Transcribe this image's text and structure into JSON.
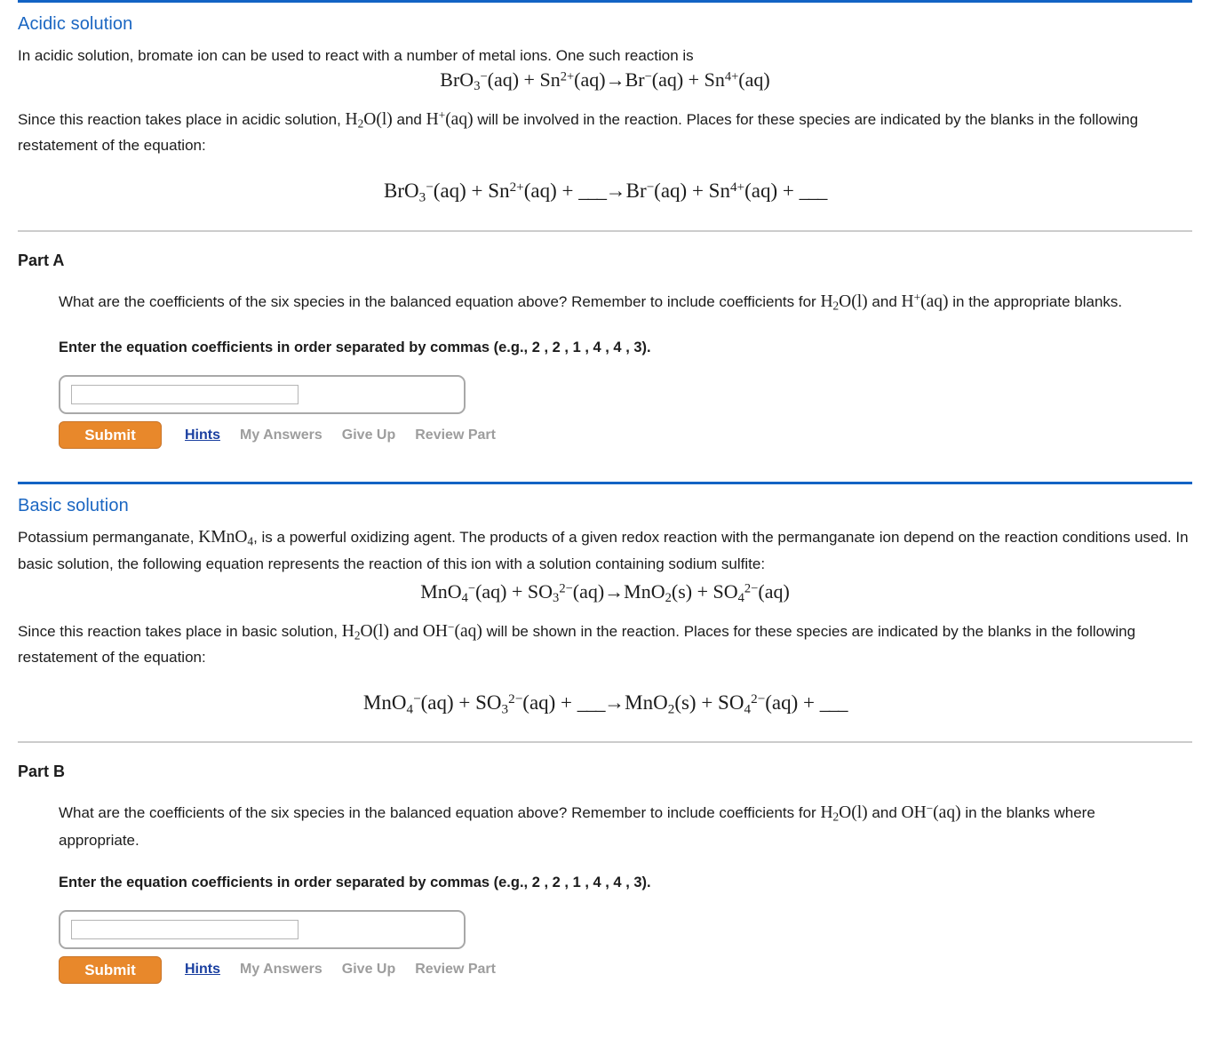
{
  "colors": {
    "section_rule": "#1263c4",
    "section_heading": "#1a66c2",
    "divider": "#cccccc",
    "submit_bg": "#e8882b",
    "link_active": "#1a3fa0",
    "link_disabled": "#9d9d9d"
  },
  "sections": {
    "acidic": {
      "heading": "Acidic solution",
      "intro_text": "In acidic solution, bromate ion can be used to react with a number of metal ions. One such reaction is",
      "equation_plain": "BrO3^-(aq) + Sn^2+(aq) → Br^-(aq) + Sn^4+(aq)",
      "since_text_1": "Since this reaction takes place in acidic solution,",
      "since_species_1": "H2O(l)",
      "since_and": "and",
      "since_species_2": "H+(aq)",
      "since_text_2": "will be involved in the reaction. Places for these species are indicated by the blanks in the following restatement of the equation:",
      "restated_equation_plain": "BrO3^-(aq) + Sn^2+(aq) + ___ → Br^-(aq) + Sn^4+(aq) + ___"
    },
    "basic": {
      "heading": "Basic solution",
      "intro_text_1": "Potassium permanganate,",
      "intro_formula": "KMnO4",
      "intro_text_2": ", is a powerful oxidizing agent. The products of a given redox reaction with the permanganate ion depend on the reaction conditions used. In basic solution, the following equation represents the reaction of this ion with a solution containing sodium sulfite:",
      "equation_plain": "MnO4^-(aq) + SO3^2-(aq) → MnO2(s) + SO4^2-(aq)",
      "since_text_1": "Since this reaction takes place in basic solution,",
      "since_species_1": "H2O(l)",
      "since_and": "and",
      "since_species_2": "OH-(aq)",
      "since_text_2": "will be shown in the reaction. Places for these species are indicated by the blanks in the following restatement of the equation:",
      "restated_equation_plain": "MnO4^-(aq) + SO3^2-(aq) + ___ → MnO2(s) + SO4^2-(aq) + ___"
    }
  },
  "parts": {
    "a": {
      "title": "Part A",
      "question_text_1": "What are the coefficients of the six species in the balanced equation above? Remember to include coefficients for",
      "question_species_1": "H2O(l)",
      "question_and": "and",
      "question_species_2": "H+(aq)",
      "question_text_2": "in the appropriate blanks.",
      "instruction_prefix": "Enter the equation coefficients in order separated by commas (e.g., ",
      "instruction_example": "2 , 2 , 1 , 4 , 4 , 3",
      "instruction_suffix": ").",
      "input_value": "",
      "input_placeholder": "",
      "submit_label": "Submit",
      "links": {
        "hints": "Hints",
        "my_answers": "My Answers",
        "give_up": "Give Up",
        "review_part": "Review Part"
      }
    },
    "b": {
      "title": "Part B",
      "question_text_1": "What are the coefficients of the six species in the balanced equation above? Remember to include coefficients for",
      "question_species_1": "H2O(l)",
      "question_and": "and",
      "question_species_2": "OH-(aq)",
      "question_text_2": "in the blanks where appropriate.",
      "instruction_prefix": "Enter the equation coefficients in order separated by commas (e.g., ",
      "instruction_example": "2 , 2 , 1 , 4 , 4 , 3",
      "instruction_suffix": ").",
      "input_value": "",
      "input_placeholder": "",
      "submit_label": "Submit",
      "links": {
        "hints": "Hints",
        "my_answers": "My Answers",
        "give_up": "Give Up",
        "review_part": "Review Part"
      }
    }
  }
}
